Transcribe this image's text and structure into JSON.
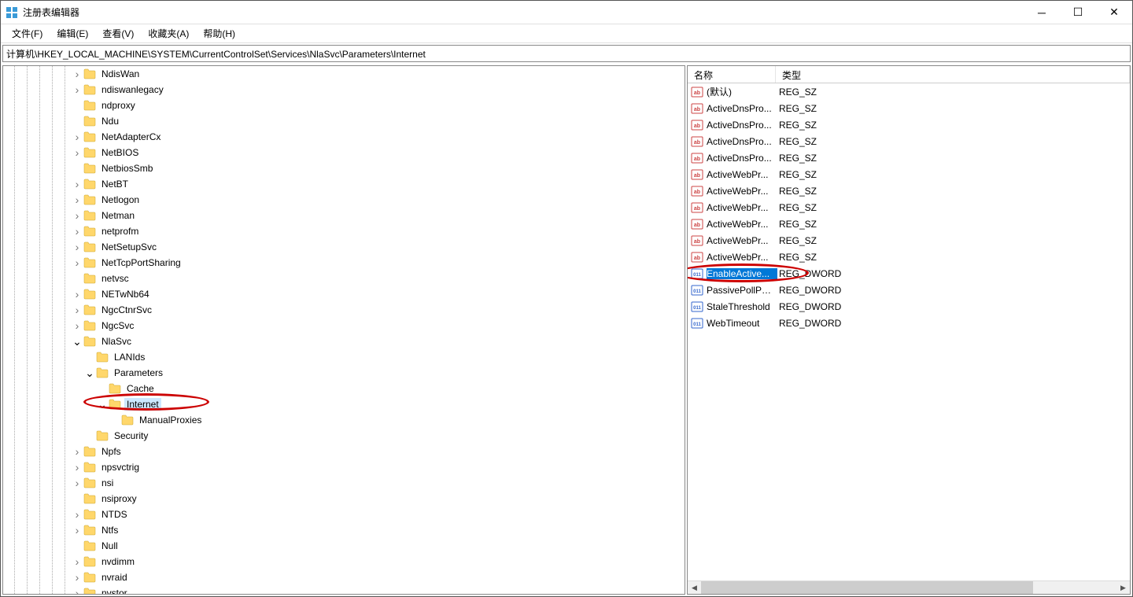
{
  "window": {
    "title": "注册表编辑器"
  },
  "menu": {
    "file": "文件(F)",
    "edit": "编辑(E)",
    "view": "查看(V)",
    "fav": "收藏夹(A)",
    "help": "帮助(H)"
  },
  "address": "计算机\\HKEY_LOCAL_MACHINE\\SYSTEM\\CurrentControlSet\\Services\\NlaSvc\\Parameters\\Internet",
  "tree": [
    {
      "indent": 5,
      "chev": ">",
      "label": "NdisWan"
    },
    {
      "indent": 5,
      "chev": ">",
      "label": "ndiswanlegacy"
    },
    {
      "indent": 5,
      "chev": "",
      "label": "ndproxy"
    },
    {
      "indent": 5,
      "chev": "",
      "label": "Ndu"
    },
    {
      "indent": 5,
      "chev": ">",
      "label": "NetAdapterCx"
    },
    {
      "indent": 5,
      "chev": ">",
      "label": "NetBIOS"
    },
    {
      "indent": 5,
      "chev": "",
      "label": "NetbiosSmb"
    },
    {
      "indent": 5,
      "chev": ">",
      "label": "NetBT"
    },
    {
      "indent": 5,
      "chev": ">",
      "label": "Netlogon"
    },
    {
      "indent": 5,
      "chev": ">",
      "label": "Netman"
    },
    {
      "indent": 5,
      "chev": ">",
      "label": "netprofm"
    },
    {
      "indent": 5,
      "chev": ">",
      "label": "NetSetupSvc"
    },
    {
      "indent": 5,
      "chev": ">",
      "label": "NetTcpPortSharing"
    },
    {
      "indent": 5,
      "chev": "",
      "label": "netvsc"
    },
    {
      "indent": 5,
      "chev": ">",
      "label": "NETwNb64"
    },
    {
      "indent": 5,
      "chev": ">",
      "label": "NgcCtnrSvc"
    },
    {
      "indent": 5,
      "chev": ">",
      "label": "NgcSvc"
    },
    {
      "indent": 5,
      "chev": "v",
      "label": "NlaSvc"
    },
    {
      "indent": 6,
      "chev": "",
      "label": "LANIds"
    },
    {
      "indent": 6,
      "chev": "v",
      "label": "Parameters"
    },
    {
      "indent": 7,
      "chev": "",
      "label": "Cache"
    },
    {
      "indent": 7,
      "chev": "v",
      "label": "Internet",
      "selected": true
    },
    {
      "indent": 8,
      "chev": "",
      "label": "ManualProxies"
    },
    {
      "indent": 6,
      "chev": "",
      "label": "Security"
    },
    {
      "indent": 5,
      "chev": ">",
      "label": "Npfs"
    },
    {
      "indent": 5,
      "chev": ">",
      "label": "npsvctrig"
    },
    {
      "indent": 5,
      "chev": ">",
      "label": "nsi"
    },
    {
      "indent": 5,
      "chev": "",
      "label": "nsiproxy"
    },
    {
      "indent": 5,
      "chev": ">",
      "label": "NTDS"
    },
    {
      "indent": 5,
      "chev": ">",
      "label": "Ntfs"
    },
    {
      "indent": 5,
      "chev": "",
      "label": "Null"
    },
    {
      "indent": 5,
      "chev": ">",
      "label": "nvdimm"
    },
    {
      "indent": 5,
      "chev": ">",
      "label": "nvraid"
    },
    {
      "indent": 5,
      "chev": ">",
      "label": "nvstor"
    }
  ],
  "list": {
    "headers": {
      "name": "名称",
      "type": "类型"
    },
    "rows": [
      {
        "icon": "sz",
        "name": "(默认)",
        "type": "REG_SZ"
      },
      {
        "icon": "sz",
        "name": "ActiveDnsPro...",
        "type": "REG_SZ"
      },
      {
        "icon": "sz",
        "name": "ActiveDnsPro...",
        "type": "REG_SZ"
      },
      {
        "icon": "sz",
        "name": "ActiveDnsPro...",
        "type": "REG_SZ"
      },
      {
        "icon": "sz",
        "name": "ActiveDnsPro...",
        "type": "REG_SZ"
      },
      {
        "icon": "sz",
        "name": "ActiveWebPr...",
        "type": "REG_SZ"
      },
      {
        "icon": "sz",
        "name": "ActiveWebPr...",
        "type": "REG_SZ"
      },
      {
        "icon": "sz",
        "name": "ActiveWebPr...",
        "type": "REG_SZ"
      },
      {
        "icon": "sz",
        "name": "ActiveWebPr...",
        "type": "REG_SZ"
      },
      {
        "icon": "sz",
        "name": "ActiveWebPr...",
        "type": "REG_SZ"
      },
      {
        "icon": "sz",
        "name": "ActiveWebPr...",
        "type": "REG_SZ"
      },
      {
        "icon": "dw",
        "name": "EnableActive...",
        "type": "REG_DWORD",
        "selected": true
      },
      {
        "icon": "dw",
        "name": "PassivePollPe...",
        "type": "REG_DWORD"
      },
      {
        "icon": "dw",
        "name": "StaleThreshold",
        "type": "REG_DWORD"
      },
      {
        "icon": "dw",
        "name": "WebTimeout",
        "type": "REG_DWORD"
      }
    ]
  }
}
